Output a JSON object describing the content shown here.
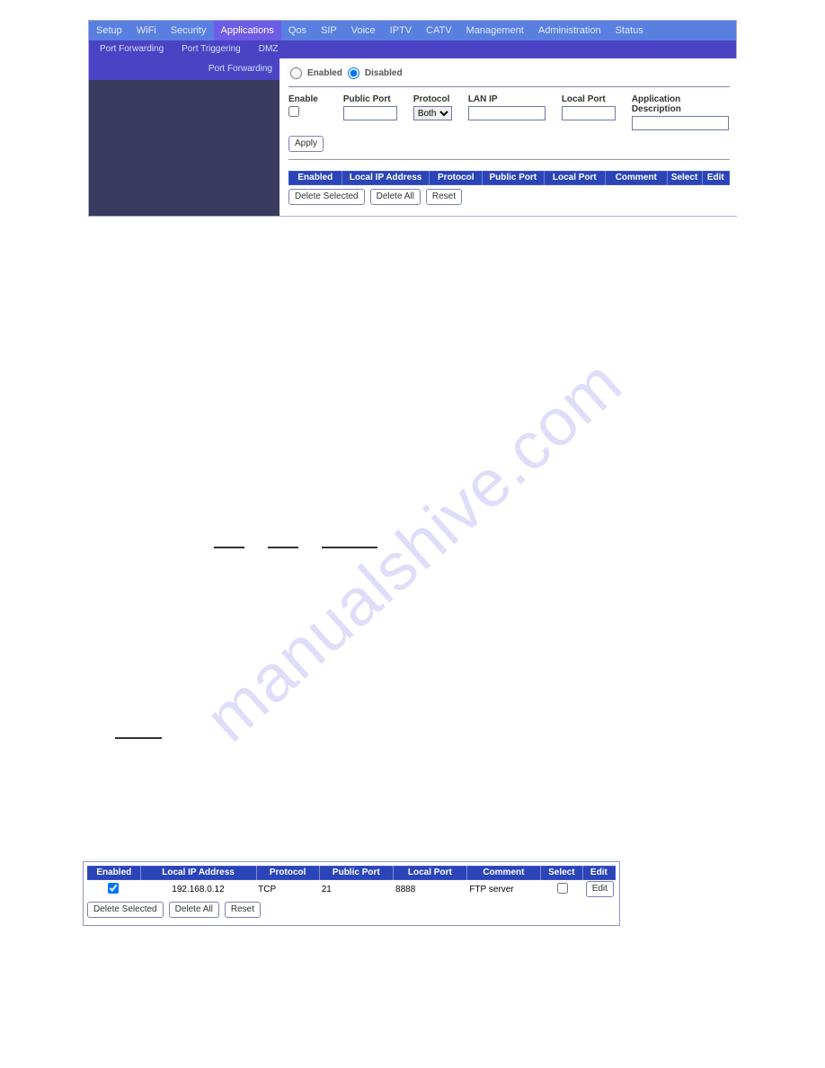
{
  "nav": {
    "items": [
      "Setup",
      "WiFi",
      "Security",
      "Applications",
      "Qos",
      "SIP",
      "Voice",
      "IPTV",
      "CATV",
      "Management",
      "Administration",
      "Status"
    ],
    "active": "Applications"
  },
  "subnav": {
    "items": [
      "Port Forwarding",
      "Port Triggering",
      "DMZ"
    ]
  },
  "sidebar": {
    "label": "Port Forwarding"
  },
  "radio": {
    "enabled_label": "Enabled",
    "disabled_label": "Disabled"
  },
  "form": {
    "enable_label": "Enable",
    "public_port_label": "Public Port",
    "protocol_label": "Protocol",
    "lan_ip_label": "LAN IP",
    "local_port_label": "Local Port",
    "app_desc_label": "Application Description",
    "protocol_value": "Both"
  },
  "buttons": {
    "apply": "Apply",
    "delete_selected": "Delete Selected",
    "delete_all": "Delete All",
    "reset": "Reset",
    "edit": "Edit"
  },
  "table": {
    "headers": [
      "Enabled",
      "Local IP Address",
      "Protocol",
      "Public Port",
      "Local Port",
      "Comment",
      "Select",
      "Edit"
    ]
  },
  "lower_table": {
    "headers": [
      "Enabled",
      "Local IP Address",
      "Protocol",
      "Public Port",
      "Local Port",
      "Comment",
      "Select",
      "Edit"
    ],
    "row": {
      "enabled": true,
      "ip": "192.168.0.12",
      "protocol": "TCP",
      "public_port": "21",
      "local_port": "8888",
      "comment": "FTP server",
      "select": false
    }
  },
  "watermark": "manualshive.com"
}
